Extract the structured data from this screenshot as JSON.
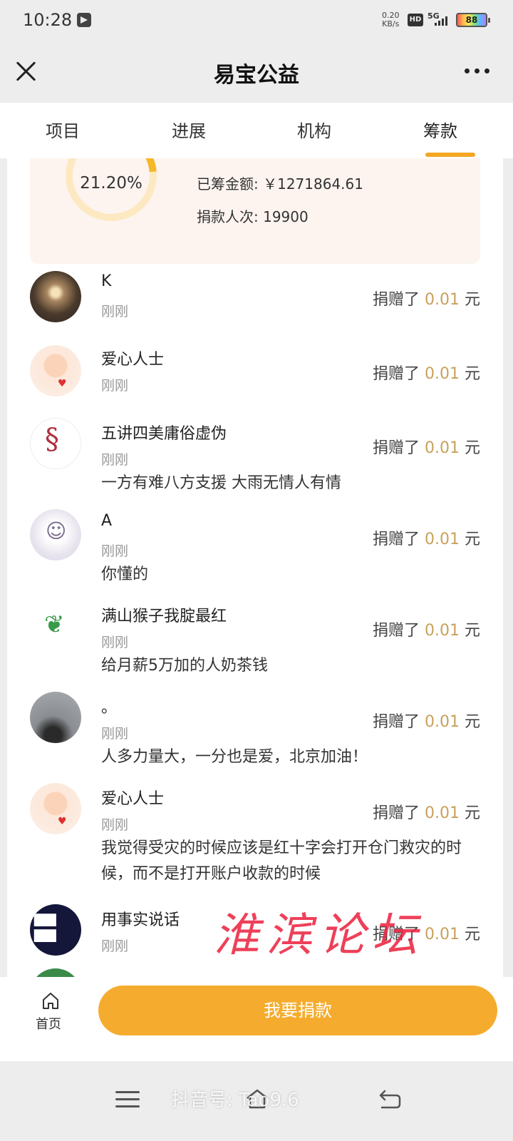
{
  "status_bar": {
    "time": "10:28",
    "net_speed_value": "0.20",
    "net_speed_unit": "KB/s",
    "hd_label": "HD",
    "network_label": "5G",
    "battery_level": "88"
  },
  "nav": {
    "title": "易宝公益"
  },
  "tabs": [
    {
      "label": "项目"
    },
    {
      "label": "进展"
    },
    {
      "label": "机构"
    },
    {
      "label": "筹款",
      "active": true
    }
  ],
  "summary": {
    "progress_percent": "21.20%",
    "progress_fraction": 0.212,
    "raised_label": "已筹金额: ￥1271864.61",
    "donations_label": "捐款人次: 19900"
  },
  "donors": [
    {
      "name": "K",
      "time": "刚刚",
      "prefix": "捐赠了",
      "amount": "0.01",
      "unit": "元",
      "message": ""
    },
    {
      "name": "爱心人士",
      "time": "刚刚",
      "prefix": "捐赠了",
      "amount": "0.01",
      "unit": "元",
      "message": ""
    },
    {
      "name": "五讲四美庸俗虚伪",
      "time": "刚刚",
      "prefix": "捐赠了",
      "amount": "0.01",
      "unit": "元",
      "message": "一方有难八方支援 大雨无情人有情"
    },
    {
      "name": "A",
      "time": "刚刚",
      "prefix": "捐赠了",
      "amount": "0.01",
      "unit": "元",
      "message": "你懂的"
    },
    {
      "name": "满山猴子我腚最红",
      "time": "刚刚",
      "prefix": "捐赠了",
      "amount": "0.01",
      "unit": "元",
      "message": "给月薪5万加的人奶茶钱"
    },
    {
      "name": "。",
      "time": "刚刚",
      "prefix": "捐赠了",
      "amount": "0.01",
      "unit": "元",
      "message": "人多力量大，一分也是爱，北京加油！"
    },
    {
      "name": "爱心人士",
      "time": "刚刚",
      "prefix": "捐赠了",
      "amount": "0.01",
      "unit": "元",
      "message": "我觉得受灾的时候应该是红十字会打开仓门救灾的时候，而不是打开账户收款的时候"
    },
    {
      "name": "用事实说话",
      "time": "刚刚",
      "prefix": "捐赠了",
      "amount": "0.01",
      "unit": "元",
      "message": ""
    }
  ],
  "bottom": {
    "home_label": "首页",
    "donate_label": "我要捐款"
  },
  "watermarks": {
    "tiktok": "抖音号: Tao9.6",
    "forum": "淮滨论坛"
  },
  "colors": {
    "accent": "#f5ac2e",
    "amount": "#c9a15b",
    "summary_bg": "#fdf4f0"
  }
}
